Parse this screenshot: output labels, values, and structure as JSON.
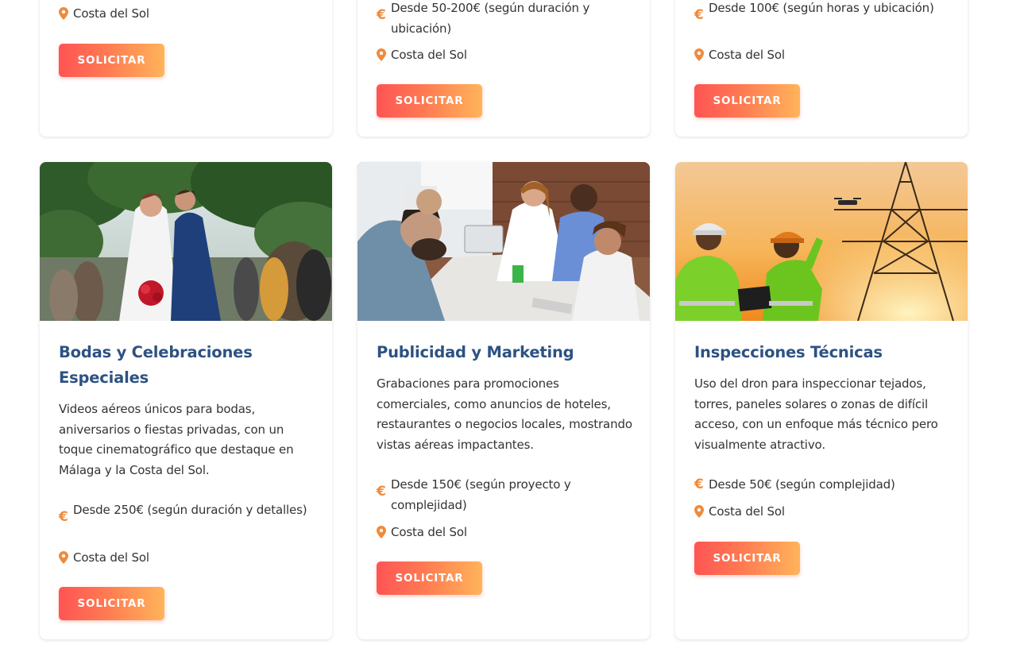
{
  "accent_color": "#ef8a3c",
  "title_color": "#2d5282",
  "top_cards": [
    {
      "price": "",
      "location": "Costa del Sol",
      "button": "SOLICITAR"
    },
    {
      "price": "Desde 50-200€ (según duración y ubicación)",
      "location": "Costa del Sol",
      "button": "SOLICITAR"
    },
    {
      "price": "Desde 100€ (según horas y ubicación)",
      "location": "Costa del Sol",
      "button": "SOLICITAR"
    }
  ],
  "cards": [
    {
      "image": "wedding-couple-photo",
      "title": "Bodas y Celebraciones Especiales",
      "description": "Videos aéreos únicos para bodas, aniversarios o fiestas privadas, con un toque cinematográfico que destaque en Málaga y la Costa del Sol.",
      "price": "Desde 250€ (según duración y detalles)",
      "location": "Costa del Sol",
      "button": "SOLICITAR"
    },
    {
      "image": "business-meeting-photo",
      "title": "Publicidad y Marketing",
      "description": "Grabaciones para promociones comerciales, como anuncios de hoteles, restaurantes o negocios locales, mostrando vistas aéreas impactantes.",
      "price": "Desde 150€ (según proyecto y complejidad)",
      "location": "Costa del Sol",
      "button": "SOLICITAR"
    },
    {
      "image": "drone-inspection-photo",
      "title": "Inspecciones Técnicas",
      "description": "Uso del dron para inspeccionar tejados, torres, paneles solares o zonas de difícil acceso, con un enfoque más técnico pero visualmente atractivo.",
      "price": "Desde 50€ (según complejidad)",
      "location": "Costa del Sol",
      "button": "SOLICITAR"
    }
  ]
}
